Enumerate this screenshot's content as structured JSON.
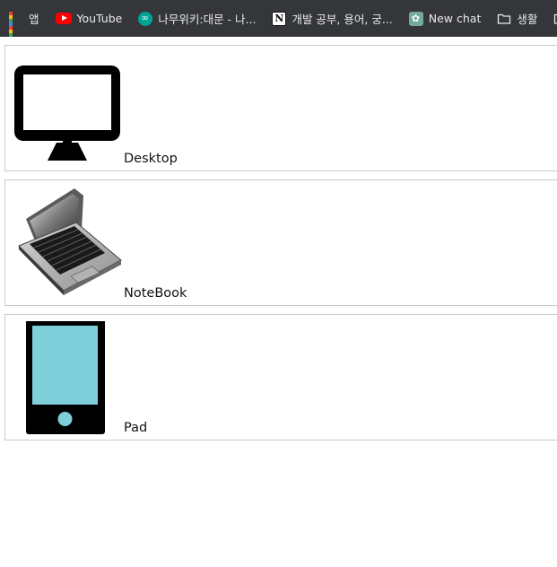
{
  "bookmarks": {
    "apps_label": "앱",
    "items": [
      {
        "label": "YouTube",
        "icon": "youtube-icon"
      },
      {
        "label": "나무위키:대문 - 나...",
        "icon": "namuwiki-icon"
      },
      {
        "label": "개발 공부, 용어, 궁...",
        "icon": "notion-icon"
      },
      {
        "label": "New chat",
        "icon": "chatgpt-icon"
      },
      {
        "label": "생활",
        "icon": "folder-icon"
      }
    ]
  },
  "devices": [
    {
      "label": "Desktop",
      "icon": "desktop-monitor-icon"
    },
    {
      "label": "NoteBook",
      "icon": "laptop-icon"
    },
    {
      "label": "Pad",
      "icon": "tablet-icon"
    }
  ],
  "colors": {
    "bar_background": "#35363a",
    "bar_text": "#e8eaed",
    "card_border": "#c9c9c9",
    "tablet_screen": "#7ecfd9"
  }
}
